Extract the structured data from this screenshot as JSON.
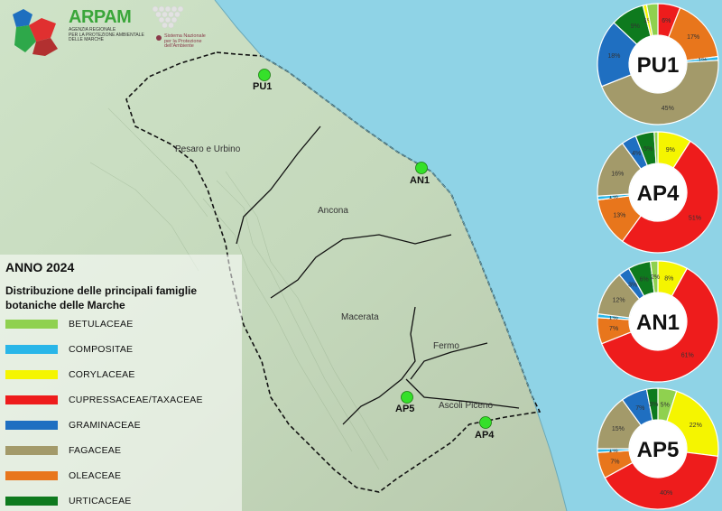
{
  "logo": {
    "title": "ARPAM",
    "subtitle_lines": [
      "AGENZIA REGIONALE",
      "PER LA PROTEZIONE AMBIENTALE",
      "DELLE MARCHE"
    ],
    "snpa_lines": [
      "Sistema Nazionale",
      "per la Protezione",
      "dell'Ambiente"
    ]
  },
  "legend": {
    "year": "ANNO 2024",
    "subtitle": "Distribuzione delle principali famiglie botaniche delle Marche",
    "items": [
      {
        "label": "BETULACEAE",
        "color": "#8fd14f"
      },
      {
        "label": "COMPOSITAE",
        "color": "#29b6e8"
      },
      {
        "label": "CORYLACEAE",
        "color": "#f5f500"
      },
      {
        "label": "CUPRESSACEAE/TAXACEAE",
        "color": "#ee1c1c"
      },
      {
        "label": "GRAMINACEAE",
        "color": "#1f6fc1"
      },
      {
        "label": "FAGACEAE",
        "color": "#a39a6a"
      },
      {
        "label": "OLEACEAE",
        "color": "#e8761c"
      },
      {
        "label": "URTICACEAE",
        "color": "#0e7a1e"
      }
    ]
  },
  "regions": [
    "Pesaro e Urbino",
    "Ancona",
    "Macerata",
    "Fermo",
    "Ascoli Piceno"
  ],
  "stations": [
    "PU1",
    "AN1",
    "AP5",
    "AP4"
  ],
  "donuts": [
    {
      "station": "PU1",
      "slices": [
        {
          "family": "CUPRESSACEAE/TAXACEAE",
          "value": 6,
          "label": "6%"
        },
        {
          "family": "OLEACEAE",
          "value": 17,
          "label": "17%"
        },
        {
          "family": "COMPOSITAE",
          "value": 1,
          "label": "1%"
        },
        {
          "family": "FAGACEAE",
          "value": 45,
          "label": "45%"
        },
        {
          "family": "GRAMINACEAE",
          "value": 18,
          "label": "18%"
        },
        {
          "family": "URTICACEAE",
          "value": 9,
          "label": "9%"
        },
        {
          "family": "CORYLACEAE",
          "value": 1,
          "label": "1%"
        },
        {
          "family": "BETULACEAE",
          "value": 3,
          "label": ""
        }
      ]
    },
    {
      "station": "AP4",
      "slices": [
        {
          "family": "CORYLACEAE",
          "value": 9,
          "label": "9%"
        },
        {
          "family": "CUPRESSACEAE/TAXACEAE",
          "value": 51,
          "label": "51%"
        },
        {
          "family": "OLEACEAE",
          "value": 13,
          "label": "13%"
        },
        {
          "family": "COMPOSITAE",
          "value": 1,
          "label": "1%"
        },
        {
          "family": "FAGACEAE",
          "value": 16,
          "label": "16%"
        },
        {
          "family": "GRAMINACEAE",
          "value": 4,
          "label": "4%"
        },
        {
          "family": "URTICACEAE",
          "value": 5,
          "label": "5%"
        },
        {
          "family": "BETULACEAE",
          "value": 1,
          "label": ""
        }
      ]
    },
    {
      "station": "AN1",
      "slices": [
        {
          "family": "CORYLACEAE",
          "value": 8,
          "label": "8%"
        },
        {
          "family": "CUPRESSACEAE/TAXACEAE",
          "value": 61,
          "label": "61%"
        },
        {
          "family": "OLEACEAE",
          "value": 7,
          "label": "7%"
        },
        {
          "family": "COMPOSITAE",
          "value": 1,
          "label": "1%"
        },
        {
          "family": "FAGACEAE",
          "value": 12,
          "label": "12%"
        },
        {
          "family": "GRAMINACEAE",
          "value": 3,
          "label": "3%"
        },
        {
          "family": "URTICACEAE",
          "value": 6,
          "label": "6%"
        },
        {
          "family": "BETULACEAE",
          "value": 2,
          "label": "2%"
        }
      ]
    },
    {
      "station": "AP5",
      "slices": [
        {
          "family": "BETULACEAE",
          "value": 5,
          "label": "5%"
        },
        {
          "family": "CORYLACEAE",
          "value": 22,
          "label": "22%"
        },
        {
          "family": "CUPRESSACEAE/TAXACEAE",
          "value": 40,
          "label": "40%"
        },
        {
          "family": "OLEACEAE",
          "value": 7,
          "label": "7%"
        },
        {
          "family": "COMPOSITAE",
          "value": 1,
          "label": "1%"
        },
        {
          "family": "FAGACEAE",
          "value": 15,
          "label": "15%"
        },
        {
          "family": "GRAMINACEAE",
          "value": 7,
          "label": "7%"
        },
        {
          "family": "URTICACEAE",
          "value": 3,
          "label": "3%"
        }
      ]
    }
  ]
}
